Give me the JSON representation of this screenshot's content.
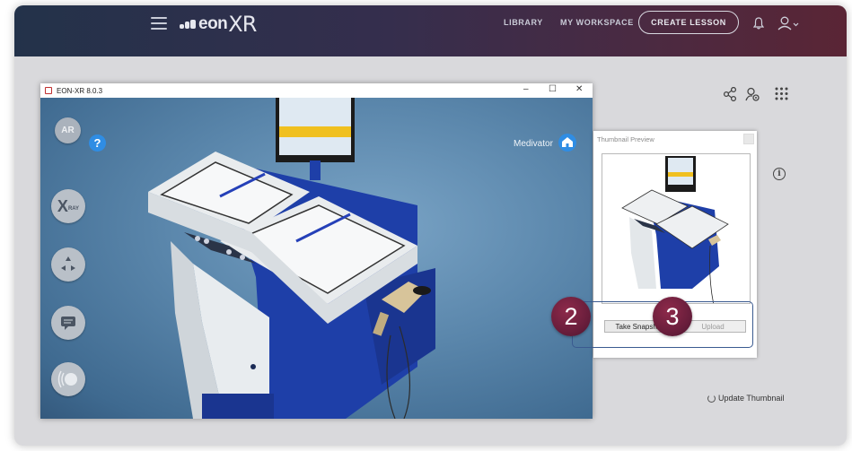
{
  "topbar": {
    "logo_text": "eon",
    "logo_xr": "XR",
    "nav": {
      "library": "LIBRARY",
      "workspace": "MY WORKSPACE",
      "create": "CREATE LESSON"
    },
    "icons": [
      "menu-icon",
      "bell-icon",
      "user-icon"
    ]
  },
  "app_window": {
    "title": "EON-XR 8.0.3",
    "controls": {
      "minimize": "–",
      "maximize": "☐",
      "close": "✕"
    },
    "toolbar": {
      "ar_label": "AR",
      "help_label": "?",
      "xray_label": "X",
      "xray_sub": "RAY"
    },
    "model_name": "Medivator"
  },
  "right_toolbar": {
    "icons": [
      "share-icon",
      "user-settings-icon",
      "apps-grid-icon"
    ]
  },
  "thumbnail_dialog": {
    "title": "Thumbnail Preview",
    "take_snapshot": "Take Snapshot",
    "upload": "Upload"
  },
  "steps": {
    "step2": "2",
    "step3": "3"
  },
  "info_symbol": "i",
  "update_thumbnail": "Update Thumbnail",
  "colors": {
    "accent_blue": "#2f8de4",
    "step_maroon": "#6a1e3c",
    "highlight": "#3a5a90",
    "machine_blue": "#1e3fa8"
  }
}
